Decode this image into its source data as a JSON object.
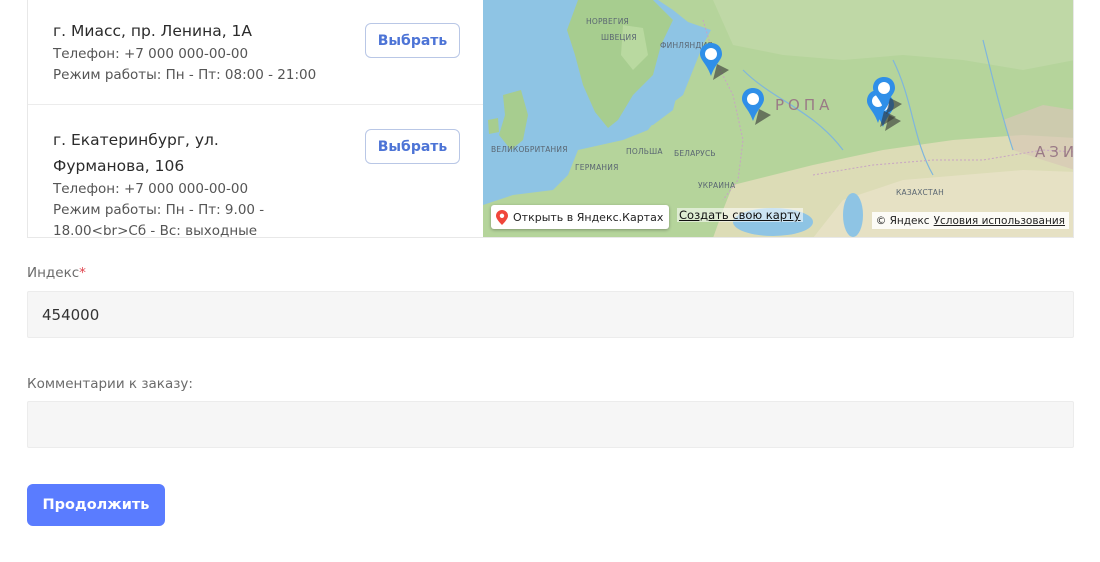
{
  "pickup_points": [
    {
      "address": "г. Миасс, пр. Ленина, 1А",
      "phone": "Телефон: +7 000 000-00-00",
      "hours": "Режим работы: Пн - Пт: 08:00 - 21:00",
      "select_label": "Выбрать"
    },
    {
      "address": "г. Екатеринбург, ул. Фурманова, 106",
      "phone": "Телефон: +7 000 000-00-00",
      "hours": "Режим работы: Пн - Пт: 9.00 - 18.00<br>Сб - Вс: выходные",
      "select_label": "Выбрать"
    }
  ],
  "map": {
    "labels": {
      "norway": "НОРВЕГИЯ",
      "sweden": "ШВЕЦИЯ",
      "finland": "ФИНЛЯНДИЯ",
      "europe": "РОПА",
      "asia": "АЗИ",
      "uk": "ВЕЛИКОБРИТАНИЯ",
      "poland": "ПОЛЬША",
      "belarus": "БЕЛАРУСЬ",
      "germany": "ГЕРМАНИЯ",
      "ukraine": "УКРАИНА",
      "kazakhstan": "КАЗАХСТАН"
    },
    "open_link": "Открыть в Яндекс.Картах",
    "create_link": "Создать свою карту",
    "copyright": "© Яндекс",
    "terms_link": "Условия использования",
    "pin_color": "#2f8fe8"
  },
  "form": {
    "index_label": "Индекс",
    "required_mark": "*",
    "index_value": "454000",
    "comment_label": "Комментарии к заказу:",
    "comment_value": "",
    "continue_label": "Продолжить"
  },
  "colors": {
    "accent": "#5a7cff",
    "select_text": "#4d74d6",
    "required": "#e0434d"
  }
}
